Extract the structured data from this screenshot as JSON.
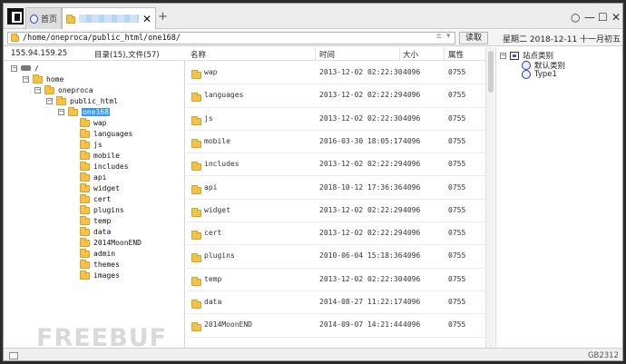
{
  "tabs": [
    {
      "label": "首页",
      "icon": "circle-icon"
    },
    {
      "label": "",
      "icon": "folder-icon"
    }
  ],
  "address": {
    "path": "/home/oneproca/public_html/one168/",
    "read_label": "读取"
  },
  "date_info": "星期二  2018-12-11  十一月初五",
  "left_header": {
    "ip": "155.94.159.25",
    "counts": "目录(15),文件(57)"
  },
  "tree": [
    {
      "label": "/",
      "level": 0,
      "expander": "⊟",
      "icon": "drive"
    },
    {
      "label": "home",
      "level": 1,
      "expander": "⊟",
      "icon": "folder"
    },
    {
      "label": "oneproca",
      "level": 2,
      "expander": "⊟",
      "icon": "folder"
    },
    {
      "label": "public_html",
      "level": 3,
      "expander": "⊟",
      "icon": "folder"
    },
    {
      "label": "one168",
      "level": 4,
      "expander": "⊟",
      "icon": "folder",
      "selected": true
    },
    {
      "label": "wap",
      "level": 5,
      "icon": "folder"
    },
    {
      "label": "languages",
      "level": 5,
      "icon": "folder"
    },
    {
      "label": "js",
      "level": 5,
      "icon": "folder"
    },
    {
      "label": "mobile",
      "level": 5,
      "icon": "folder"
    },
    {
      "label": "includes",
      "level": 5,
      "icon": "folder"
    },
    {
      "label": "api",
      "level": 5,
      "icon": "folder"
    },
    {
      "label": "widget",
      "level": 5,
      "icon": "folder"
    },
    {
      "label": "cert",
      "level": 5,
      "icon": "folder"
    },
    {
      "label": "plugins",
      "level": 5,
      "icon": "folder"
    },
    {
      "label": "temp",
      "level": 5,
      "icon": "folder"
    },
    {
      "label": "data",
      "level": 5,
      "icon": "folder"
    },
    {
      "label": "2014MoonEND",
      "level": 5,
      "icon": "folder"
    },
    {
      "label": "admin",
      "level": 5,
      "icon": "folder"
    },
    {
      "label": "themes",
      "level": 5,
      "icon": "folder"
    },
    {
      "label": "images",
      "level": 5,
      "icon": "folder"
    }
  ],
  "list_headers": {
    "name": "名称",
    "time": "时间",
    "size": "大小",
    "attr": "属性"
  },
  "files": [
    {
      "name": "wap",
      "time": "2013-12-02 02:22:30",
      "size": "4096",
      "attr": "0755"
    },
    {
      "name": "languages",
      "time": "2013-12-02 02:22:29",
      "size": "4096",
      "attr": "0755"
    },
    {
      "name": "js",
      "time": "2013-12-02 02:22:30",
      "size": "4096",
      "attr": "0755"
    },
    {
      "name": "mobile",
      "time": "2016-03-30 18:05:17",
      "size": "4096",
      "attr": "0755"
    },
    {
      "name": "includes",
      "time": "2013-12-02 02:22:29",
      "size": "4096",
      "attr": "0755"
    },
    {
      "name": "api",
      "time": "2018-10-12 17:36:36",
      "size": "4096",
      "attr": "0755"
    },
    {
      "name": "widget",
      "time": "2013-12-02 02:22:29",
      "size": "4096",
      "attr": "0755"
    },
    {
      "name": "cert",
      "time": "2013-12-02 02:22:29",
      "size": "4096",
      "attr": "0755"
    },
    {
      "name": "plugins",
      "time": "2010-06-04 15:18:36",
      "size": "4096",
      "attr": "0755"
    },
    {
      "name": "temp",
      "time": "2013-12-02 02:22:30",
      "size": "4096",
      "attr": "0755"
    },
    {
      "name": "data",
      "time": "2014-08-27 11:22:17",
      "size": "4096",
      "attr": "0755"
    },
    {
      "name": "2014MoonEND",
      "time": "2014-09-07 14:21:44",
      "size": "4096",
      "attr": "0755"
    }
  ],
  "site_tree": {
    "root": "站点类别",
    "items": [
      "默认类别",
      "Type1"
    ]
  },
  "status": {
    "encoding": "GB2312"
  },
  "watermark": "FREEBUF"
}
